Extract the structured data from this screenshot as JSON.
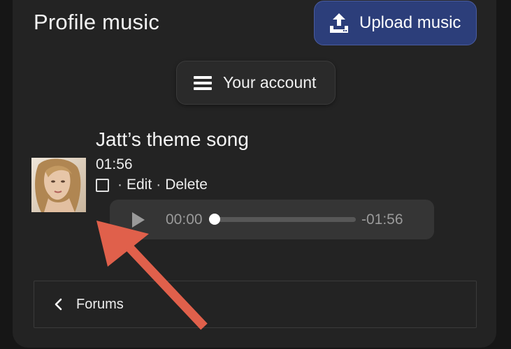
{
  "header": {
    "title": "Profile music",
    "upload_label": "Upload music"
  },
  "account_menu": {
    "label": "Your account"
  },
  "song": {
    "title": "Jatt’s theme song",
    "duration": "01:56",
    "separator": "·",
    "edit_label": "Edit",
    "delete_label": "Delete",
    "thumbnail_icon": "portrait-photo"
  },
  "player": {
    "current_time": "00:00",
    "remaining_time": "-01:56",
    "progress_fraction": 0.0
  },
  "footer": {
    "forums_label": "Forums"
  },
  "colors": {
    "upload_button_bg": "#2c3e7a",
    "annotation_arrow": "#e0604b"
  }
}
